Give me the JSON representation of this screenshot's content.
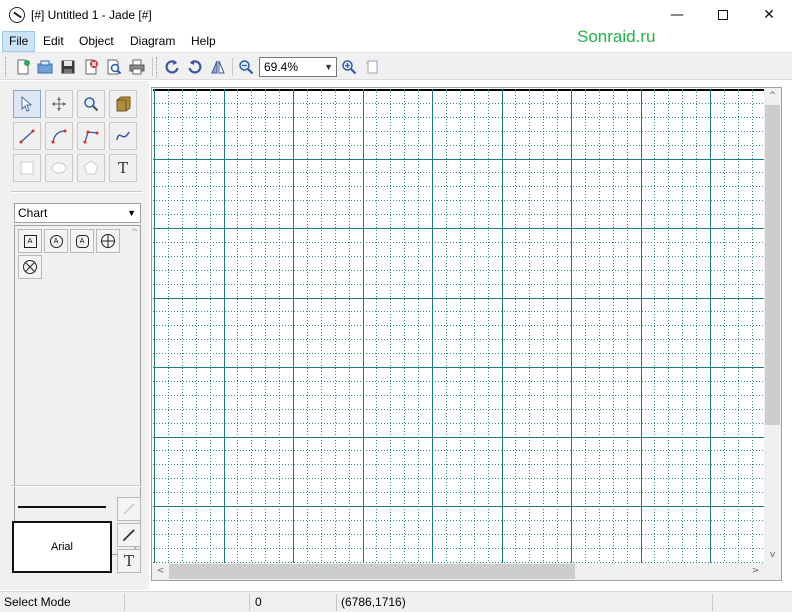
{
  "window": {
    "title": "[#] Untitled 1 - Jade [#]",
    "min_glyph": "—",
    "close_glyph": "✕"
  },
  "watermark": "Sonraid.ru",
  "menu": [
    "File",
    "Edit",
    "Object",
    "Diagram",
    "Help"
  ],
  "toolbar": {
    "zoom_value": "69.4%",
    "icons": [
      "new-file-icon",
      "open-icon",
      "save-icon",
      "close-file-icon",
      "print-preview-icon",
      "print-icon",
      "rotate-left-icon",
      "rotate-right-icon",
      "flip-icon",
      "zoom-out-icon",
      "zoom-in-icon",
      "page-icon"
    ]
  },
  "tools": {
    "icons": [
      "pointer-icon",
      "move-icon",
      "zoom-tool-icon",
      "fill-icon",
      "line-icon",
      "arc-icon",
      "polyline-icon",
      "curve-icon",
      "rectangle-icon",
      "ellipse-icon",
      "polygon-icon"
    ],
    "text_label": "T"
  },
  "palette": {
    "selected": "Chart",
    "shapes": [
      {
        "name": "box-a-shape",
        "label": "A"
      },
      {
        "name": "circle-a-shape",
        "label": "A"
      },
      {
        "name": "rounded-a-shape",
        "label": "A"
      },
      {
        "name": "crosshair-circle-shape",
        "label": ""
      },
      {
        "name": "x-circle-shape",
        "label": ""
      }
    ]
  },
  "style": {
    "font_name": "Arial",
    "text_label": "T"
  },
  "status": {
    "mode": "Select Mode",
    "count": "0",
    "coords": "(6786,1716)"
  },
  "colors": {
    "grid_major": "#1f7a80",
    "grid_minor": "#2a8a8f",
    "accent": "#22b24c"
  }
}
